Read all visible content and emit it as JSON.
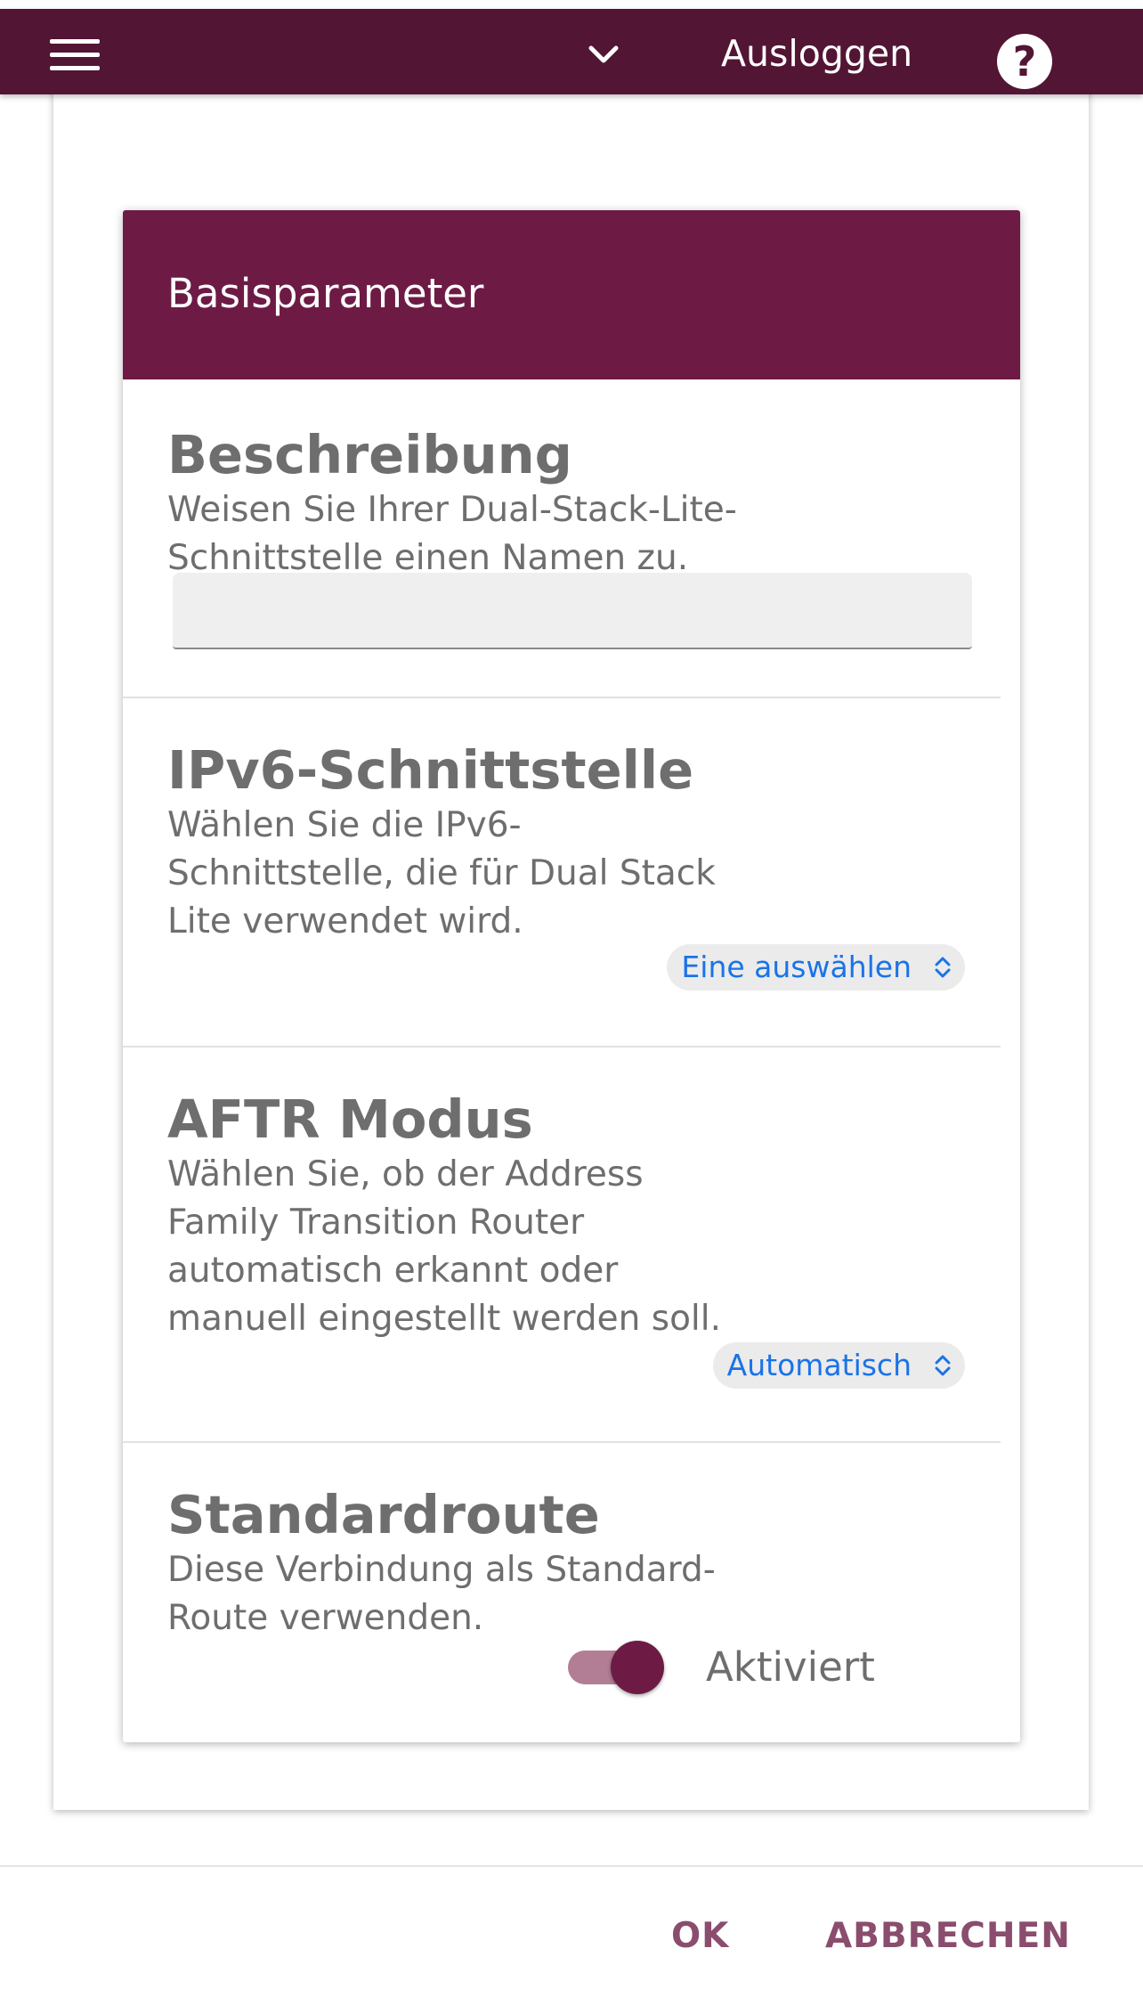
{
  "header": {
    "logout_label": "Ausloggen",
    "help_glyph": "?",
    "menu_icon": "hamburger-menu-icon",
    "dropdown_icon": "chevron-down-icon"
  },
  "card": {
    "title": "Basisparameter"
  },
  "sections": {
    "description": {
      "title": "Beschreibung",
      "text": "Weisen Sie Ihrer Dual-Stack-Lite-Schnittstelle einen Namen zu.",
      "input_value": ""
    },
    "ipv6": {
      "title": "IPv6-Schnittstelle",
      "text": "Wählen Sie die IPv6-Schnittstelle, die für Dual Stack Lite verwendet wird.",
      "select_value": "Eine auswählen"
    },
    "aftr": {
      "title": "AFTR Modus",
      "text": "Wählen Sie, ob der Address Family Transition Router automatisch erkannt oder manuell eingestellt werden soll.",
      "select_value": "Automatisch"
    },
    "default_route": {
      "title": "Standardroute",
      "text": "Diese Verbindung als Standard-Route verwenden.",
      "toggle_on": true,
      "toggle_label": "Aktiviert"
    }
  },
  "footer": {
    "ok_label": "OK",
    "cancel_label": "ABBRECHEN"
  },
  "colors": {
    "header_bg": "#531534",
    "card_header_bg": "#6d1b45",
    "accent_text": "#8a4d6e",
    "select_text": "#1a73e8"
  }
}
